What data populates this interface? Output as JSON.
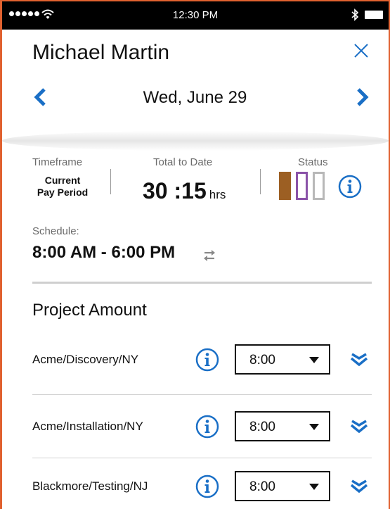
{
  "status_bar": {
    "time": "12:30 PM"
  },
  "header": {
    "name": "Michael Martin",
    "date": "Wed, June 29"
  },
  "stats": {
    "timeframe_label": "Timeframe",
    "timeframe_value_line1": "Current",
    "timeframe_value_line2": "Pay Period",
    "total_label": "Total to Date",
    "total_value": "30 :15",
    "total_unit": "hrs",
    "status_label": "Status",
    "status_colors": [
      "#9c5f23",
      "#8a52a8",
      "#b8b8b8"
    ]
  },
  "schedule": {
    "label": "Schedule:",
    "value": "8:00 AM - 6:00 PM"
  },
  "projects": {
    "title": "Project Amount",
    "items": [
      {
        "name": "Acme/Discovery/NY",
        "amount": "8:00"
      },
      {
        "name": "Acme/Installation/NY",
        "amount": "8:00"
      },
      {
        "name": "Blackmore/Testing/NJ",
        "amount": "8:00"
      }
    ]
  },
  "colors": {
    "accent": "#1a6fc6",
    "frame": "#e0612f"
  }
}
